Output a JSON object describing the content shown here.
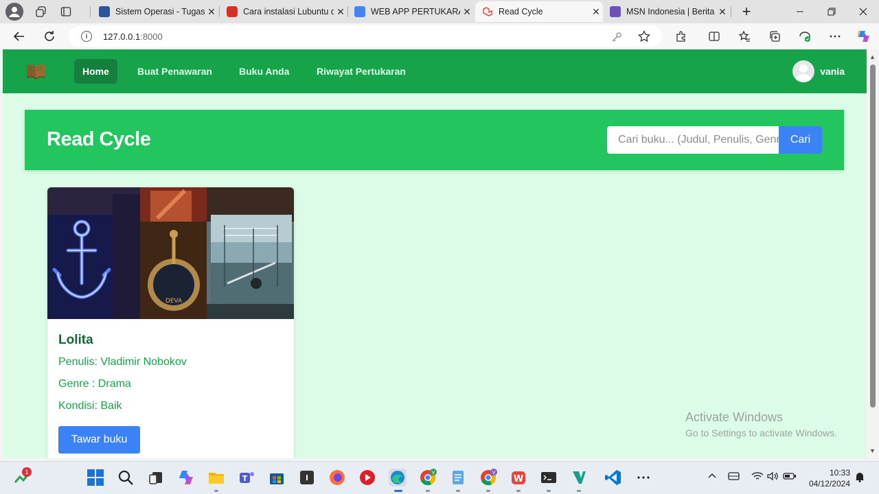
{
  "browser": {
    "tabs": [
      {
        "title": "Sistem Operasi - Tugas",
        "color": "#2b579a"
      },
      {
        "title": "Cara instalasi Lubuntu d",
        "color": "#d93025"
      },
      {
        "title": "WEB APP PERTUKARAN",
        "color": "#4285f4"
      },
      {
        "title": "Read Cycle",
        "color": "#ff2d20"
      },
      {
        "title": "MSN Indonesia | Berita",
        "color": "#6b4fbb"
      }
    ],
    "url_host": "127.0.0.1",
    "url_port": ":8000",
    "close_glyph": "✕",
    "new_tab_glyph": "+"
  },
  "navbar": {
    "links": [
      "Home",
      "Buat Penawaran",
      "Buku Anda",
      "Riwayat Pertukaran"
    ],
    "active": "Home",
    "username": "vania"
  },
  "hero": {
    "title": "Read Cycle",
    "search_placeholder": "Cari buku... (Judul, Penulis, Genre)",
    "search_button": "Cari"
  },
  "books": [
    {
      "title": "Lolita",
      "author_line": "Penulis: Vladimir Nobokov",
      "genre_line": "Genre : Drama",
      "condition_line": "Kondisi: Baik",
      "button": "Tawar buku"
    }
  ],
  "watermark": {
    "line1": "Activate Windows",
    "line2": "Go to Settings to activate Windows."
  },
  "taskbar": {
    "notification_count": "1",
    "time": "10:33",
    "date": "04/12/2024"
  },
  "colors": {
    "navbar": "#16a34a",
    "page_bg": "#dcfce7",
    "hero": "#22c55e",
    "button": "#3b82f6"
  }
}
